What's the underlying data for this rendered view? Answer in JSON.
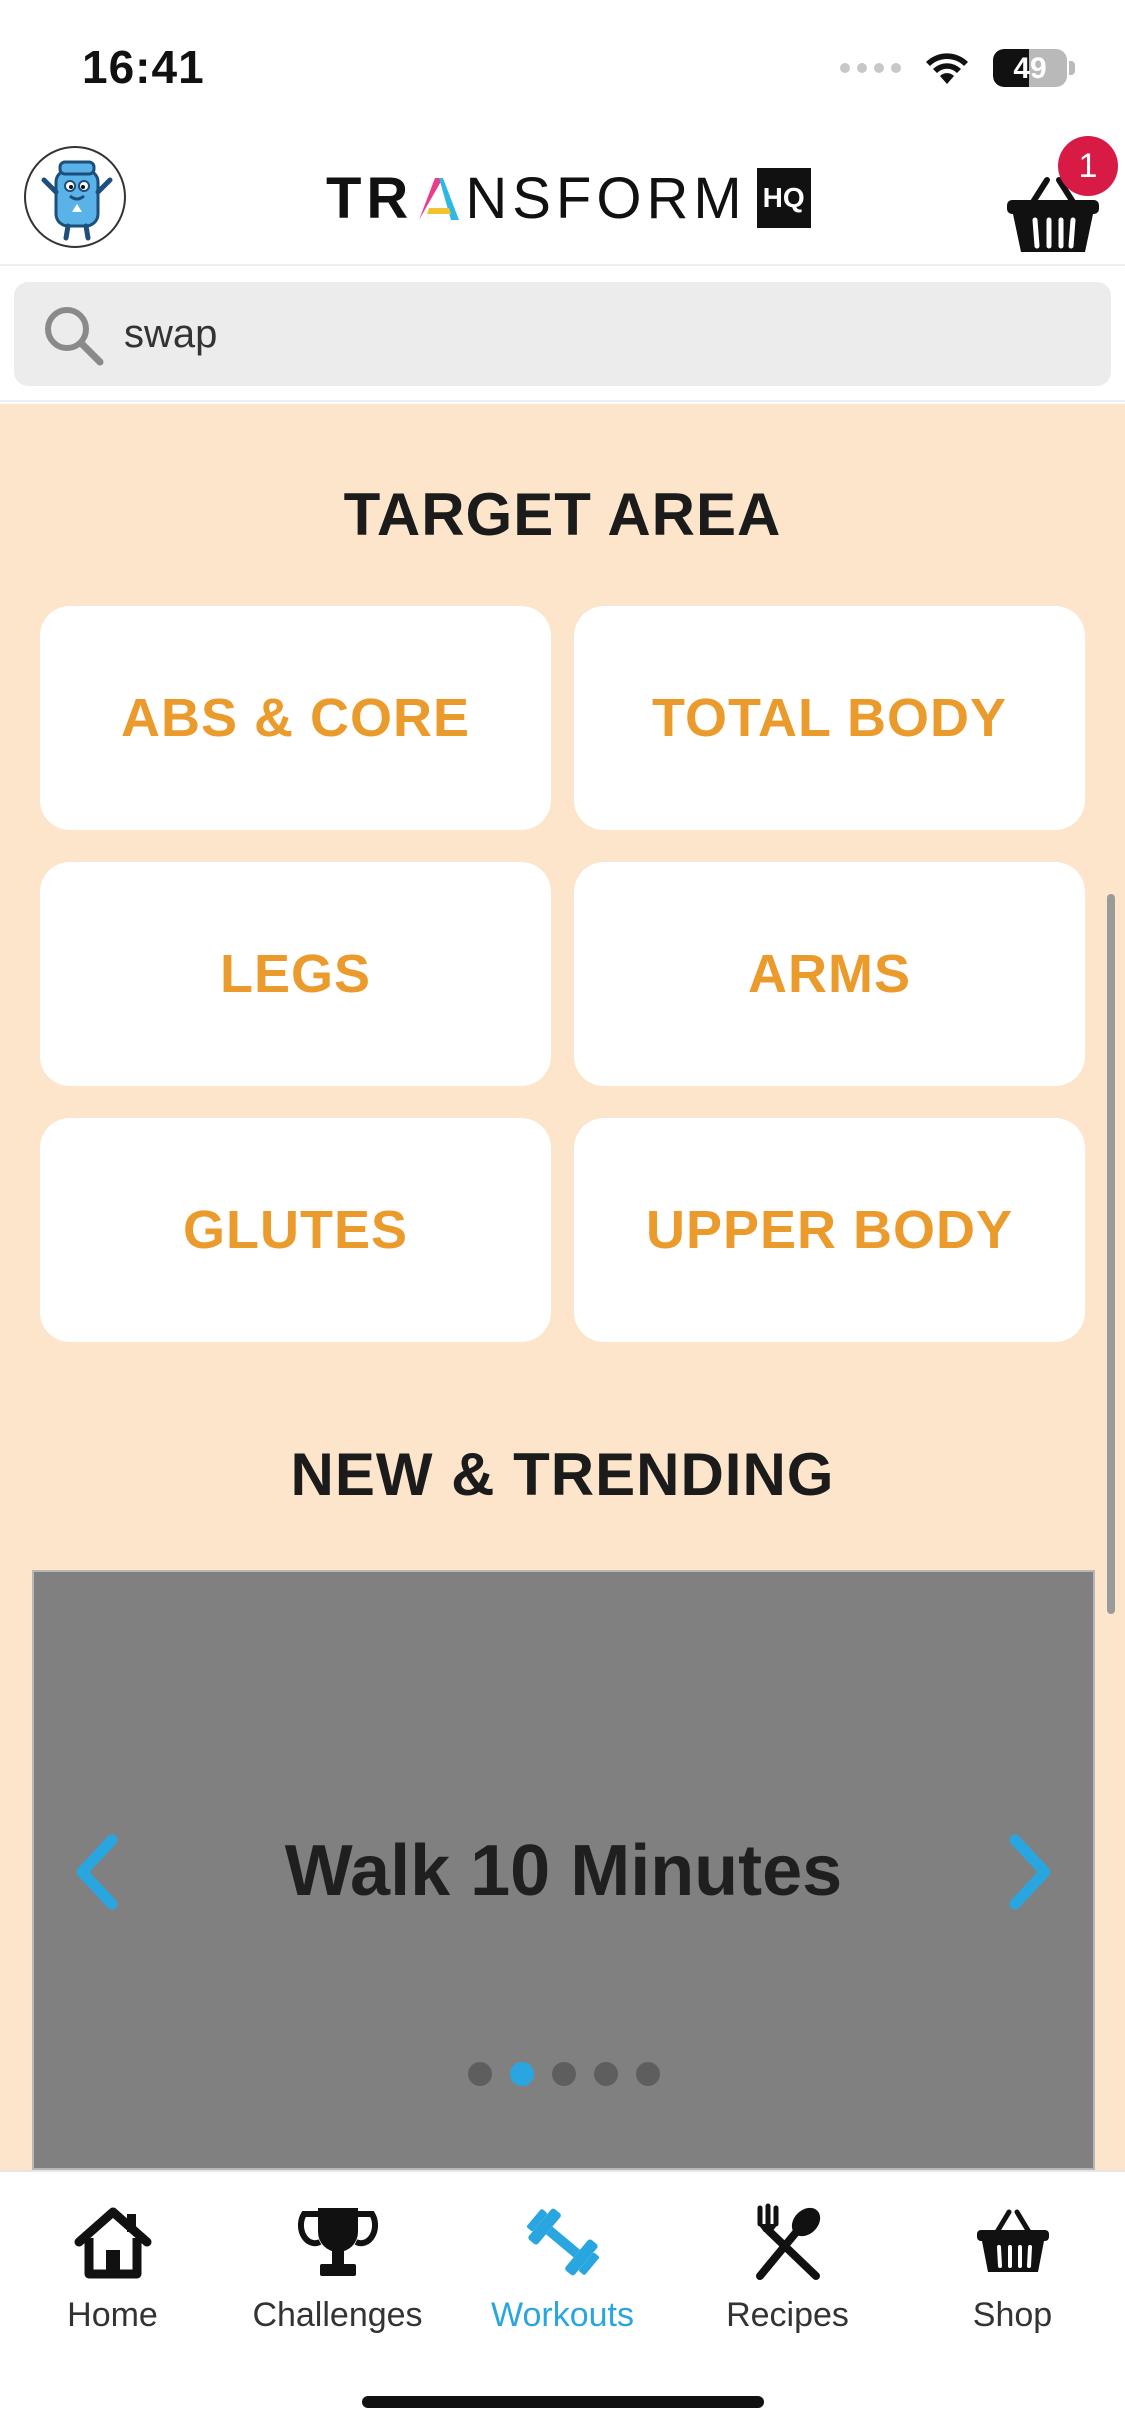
{
  "status_bar": {
    "time": "16:41",
    "battery": "49",
    "battery_level": 0.49
  },
  "header": {
    "logo_text_pre": "TR",
    "logo_text_a": "A",
    "logo_text_post": "NSFORM",
    "logo_badge": "HQ",
    "cart_count": "1",
    "avatar_icon": "mascot-avatar-icon",
    "cart_icon": "basket-icon"
  },
  "search": {
    "value": "swap",
    "icon": "search-icon"
  },
  "target_area": {
    "title": "TARGET AREA",
    "items": [
      {
        "label": "ABS & CORE"
      },
      {
        "label": "TOTAL BODY"
      },
      {
        "label": "LEGS"
      },
      {
        "label": "ARMS"
      },
      {
        "label": "GLUTES"
      },
      {
        "label": "UPPER BODY"
      }
    ]
  },
  "new_trending": {
    "title": "NEW & TRENDING",
    "slide_title": "Walk 10 Minutes",
    "slide_count": 5,
    "active_slide": 2
  },
  "tab_bar": {
    "items": [
      {
        "label": "Home",
        "icon": "home-icon"
      },
      {
        "label": "Challenges",
        "icon": "trophy-icon"
      },
      {
        "label": "Workouts",
        "icon": "dumbbell-icon",
        "active": true
      },
      {
        "label": "Recipes",
        "icon": "fork-spoon-icon"
      },
      {
        "label": "Shop",
        "icon": "basket-icon"
      }
    ]
  },
  "colors": {
    "accent": "#29a6e0",
    "tile_text": "#eb9a2c",
    "content_bg": "#fde5cb",
    "badge": "#d81b45",
    "logo_a": [
      "#e83e8c",
      "#2fb8e6",
      "#f2c230"
    ]
  }
}
